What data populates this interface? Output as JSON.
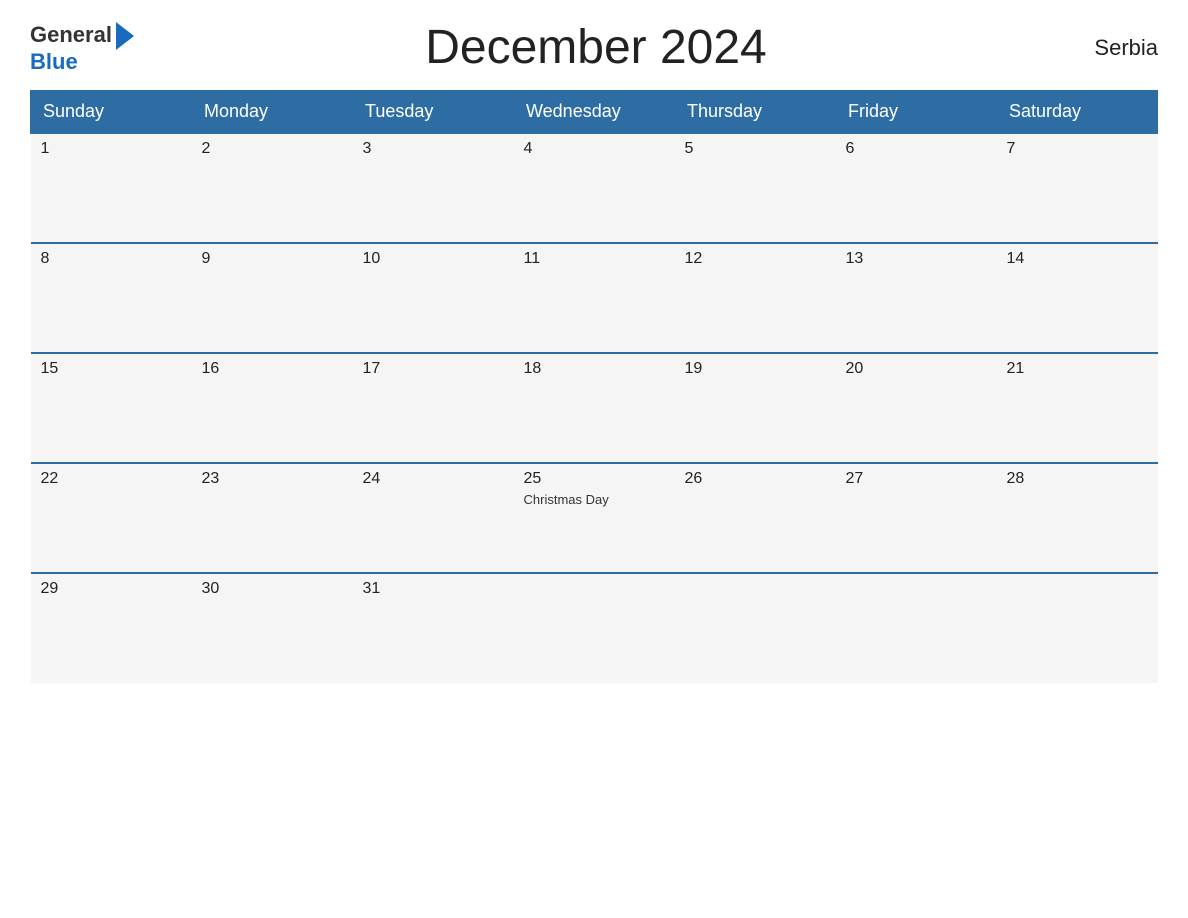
{
  "header": {
    "logo_general": "General",
    "logo_blue": "Blue",
    "title": "December 2024",
    "country": "Serbia"
  },
  "days_of_week": [
    "Sunday",
    "Monday",
    "Tuesday",
    "Wednesday",
    "Thursday",
    "Friday",
    "Saturday"
  ],
  "weeks": [
    [
      {
        "day": "1",
        "holiday": ""
      },
      {
        "day": "2",
        "holiday": ""
      },
      {
        "day": "3",
        "holiday": ""
      },
      {
        "day": "4",
        "holiday": ""
      },
      {
        "day": "5",
        "holiday": ""
      },
      {
        "day": "6",
        "holiday": ""
      },
      {
        "day": "7",
        "holiday": ""
      }
    ],
    [
      {
        "day": "8",
        "holiday": ""
      },
      {
        "day": "9",
        "holiday": ""
      },
      {
        "day": "10",
        "holiday": ""
      },
      {
        "day": "11",
        "holiday": ""
      },
      {
        "day": "12",
        "holiday": ""
      },
      {
        "day": "13",
        "holiday": ""
      },
      {
        "day": "14",
        "holiday": ""
      }
    ],
    [
      {
        "day": "15",
        "holiday": ""
      },
      {
        "day": "16",
        "holiday": ""
      },
      {
        "day": "17",
        "holiday": ""
      },
      {
        "day": "18",
        "holiday": ""
      },
      {
        "day": "19",
        "holiday": ""
      },
      {
        "day": "20",
        "holiday": ""
      },
      {
        "day": "21",
        "holiday": ""
      }
    ],
    [
      {
        "day": "22",
        "holiday": ""
      },
      {
        "day": "23",
        "holiday": ""
      },
      {
        "day": "24",
        "holiday": ""
      },
      {
        "day": "25",
        "holiday": "Christmas Day"
      },
      {
        "day": "26",
        "holiday": ""
      },
      {
        "day": "27",
        "holiday": ""
      },
      {
        "day": "28",
        "holiday": ""
      }
    ],
    [
      {
        "day": "29",
        "holiday": ""
      },
      {
        "day": "30",
        "holiday": ""
      },
      {
        "day": "31",
        "holiday": ""
      },
      {
        "day": "",
        "holiday": ""
      },
      {
        "day": "",
        "holiday": ""
      },
      {
        "day": "",
        "holiday": ""
      },
      {
        "day": "",
        "holiday": ""
      }
    ]
  ]
}
